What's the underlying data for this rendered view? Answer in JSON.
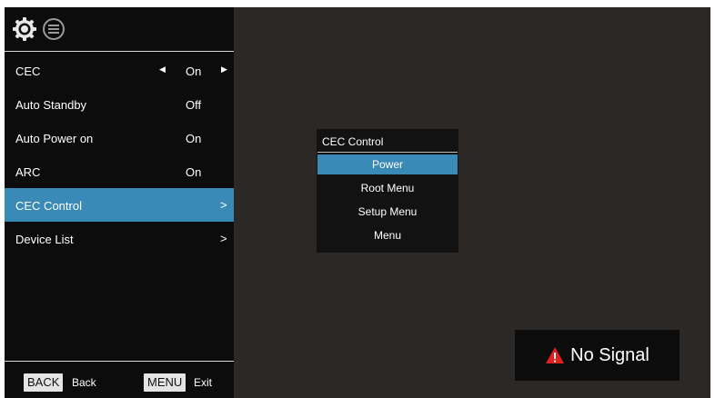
{
  "icons": {
    "settings": "gear-icon",
    "info": "list-icon",
    "warning": "warning-triangle-icon"
  },
  "menu": {
    "items": [
      {
        "label": "CEC",
        "value": "On",
        "left_arrow": "◀",
        "right_arrow": "▶"
      },
      {
        "label": "Auto Standby",
        "value": "Off"
      },
      {
        "label": "Auto Power on",
        "value": "On"
      },
      {
        "label": "ARC",
        "value": "On"
      },
      {
        "label": "CEC Control",
        "chevron": ">"
      },
      {
        "label": "Device List",
        "chevron": ">"
      }
    ],
    "selected_index": 4
  },
  "footer": {
    "back_key": "BACK",
    "back_label": "Back",
    "menu_key": "MENU",
    "menu_label": "Exit"
  },
  "popup": {
    "title": "CEC Control",
    "options": [
      "Power",
      "Root Menu",
      "Setup Menu",
      "Menu"
    ],
    "selected_index": 0
  },
  "status": {
    "no_signal": "No Signal"
  },
  "colors": {
    "highlight": "#3a8ab8",
    "background": "#2b2826",
    "panel": "#0c0c0c",
    "warning": "#e02020"
  }
}
